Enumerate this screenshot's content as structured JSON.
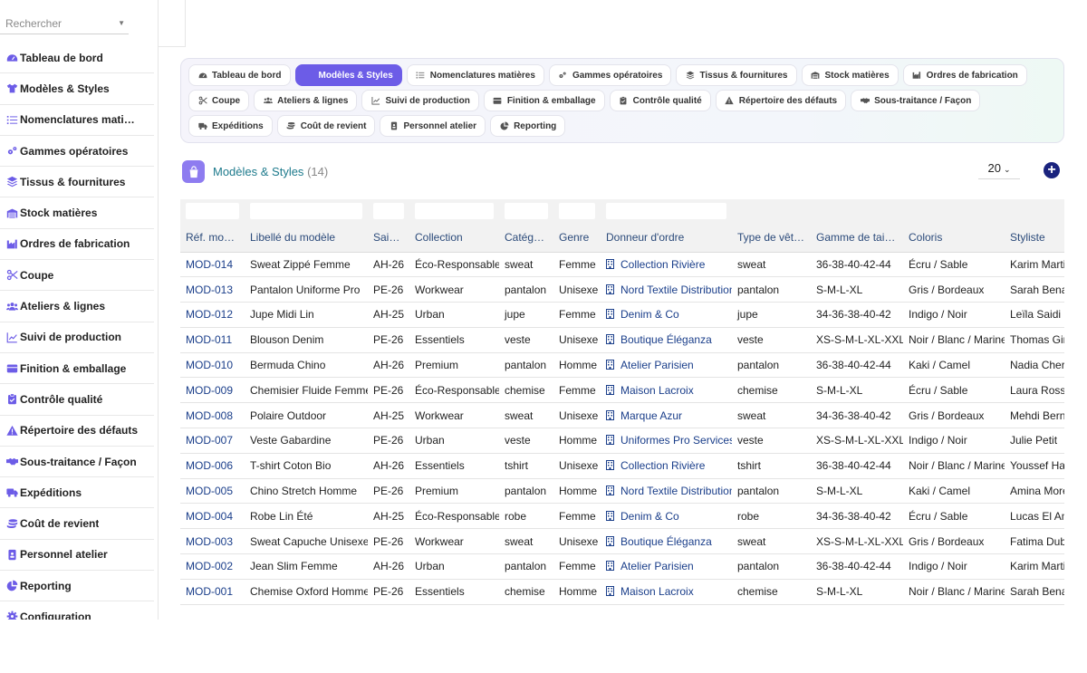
{
  "search": {
    "placeholder": "Rechercher"
  },
  "sidebar": {
    "items": [
      {
        "label": "Tableau de bord",
        "icon": "dashboard-icon"
      },
      {
        "label": "Modèles & Styles",
        "icon": "shirt-icon"
      },
      {
        "label": "Nomenclatures mati…",
        "icon": "list-icon"
      },
      {
        "label": "Gammes opératoires",
        "icon": "cogs-icon"
      },
      {
        "label": "Tissus & fournitures",
        "icon": "layers-icon"
      },
      {
        "label": "Stock matières",
        "icon": "warehouse-icon"
      },
      {
        "label": "Ordres de fabrication",
        "icon": "factory-icon"
      },
      {
        "label": "Coupe",
        "icon": "scissors-icon"
      },
      {
        "label": "Ateliers & lignes",
        "icon": "users-icon"
      },
      {
        "label": "Suivi de production",
        "icon": "chart-line-icon"
      },
      {
        "label": "Finition & emballage",
        "icon": "box-icon"
      },
      {
        "label": "Contrôle qualité",
        "icon": "clipboard-check-icon"
      },
      {
        "label": "Répertoire des défauts",
        "icon": "warning-icon"
      },
      {
        "label": "Sous-traitance / Façon",
        "icon": "handshake-icon"
      },
      {
        "label": "Expéditions",
        "icon": "truck-icon"
      },
      {
        "label": "Coût de revient",
        "icon": "coins-icon"
      },
      {
        "label": "Personnel atelier",
        "icon": "id-badge-icon"
      },
      {
        "label": "Reporting",
        "icon": "pie-chart-icon"
      },
      {
        "label": "Configuration",
        "icon": "gear-icon"
      }
    ]
  },
  "tabs": [
    {
      "label": "Tableau de bord",
      "icon": "dashboard-icon",
      "active": false
    },
    {
      "label": "Modèles & Styles",
      "icon": "shirt-icon",
      "active": true
    },
    {
      "label": "Nomenclatures matières",
      "icon": "list-icon",
      "active": false
    },
    {
      "label": "Gammes opératoires",
      "icon": "cogs-icon",
      "active": false
    },
    {
      "label": "Tissus & fournitures",
      "icon": "layers-icon",
      "active": false
    },
    {
      "label": "Stock matières",
      "icon": "warehouse-icon",
      "active": false
    },
    {
      "label": "Ordres de fabrication",
      "icon": "factory-icon",
      "active": false
    },
    {
      "label": "Coupe",
      "icon": "scissors-icon",
      "active": false
    },
    {
      "label": "Ateliers & lignes",
      "icon": "users-icon",
      "active": false
    },
    {
      "label": "Suivi de production",
      "icon": "chart-line-icon",
      "active": false
    },
    {
      "label": "Finition & emballage",
      "icon": "box-icon",
      "active": false
    },
    {
      "label": "Contrôle qualité",
      "icon": "clipboard-check-icon",
      "active": false
    },
    {
      "label": "Répertoire des défauts",
      "icon": "warning-icon",
      "active": false
    },
    {
      "label": "Sous-traitance / Façon",
      "icon": "handshake-icon",
      "active": false
    },
    {
      "label": "Expéditions",
      "icon": "truck-icon",
      "active": false
    },
    {
      "label": "Coût de revient",
      "icon": "coins-icon",
      "active": false
    },
    {
      "label": "Personnel atelier",
      "icon": "id-badge-icon",
      "active": false
    },
    {
      "label": "Reporting",
      "icon": "pie-chart-icon",
      "active": false
    }
  ],
  "page": {
    "title": "Modèles & Styles",
    "count": "(14)",
    "icon": "shopping-bag-icon",
    "page_size": "20",
    "add_icon": "plus-circle-icon"
  },
  "colors": {
    "accent": "#6c5ce7",
    "link": "#1a3e8a",
    "title": "#1d7a8c",
    "add_button": "#1a237e"
  },
  "table": {
    "columns": [
      "Réf. modèle",
      "Libellé du modèle",
      "Saison",
      "Collection",
      "Catégorie",
      "Genre",
      "Donneur d'ordre",
      "Type de vête…",
      "Gamme de tailles",
      "Coloris",
      "Styliste"
    ],
    "filter_columns": [
      true,
      true,
      true,
      true,
      true,
      true,
      true,
      false,
      false,
      false,
      false
    ],
    "rows": [
      [
        "MOD-014",
        "Sweat Zippé Femme",
        "AH-26",
        "Éco-Responsable",
        "sweat",
        "Femme",
        "Collection Rivière",
        "sweat",
        "36-38-40-42-44",
        "Écru / Sable",
        "Karim Martin"
      ],
      [
        "MOD-013",
        "Pantalon Uniforme Pro",
        "PE-26",
        "Workwear",
        "pantalon",
        "Unisexe",
        "Nord Textile Distribution",
        "pantalon",
        "S-M-L-XL",
        "Gris / Bordeaux",
        "Sarah Benali"
      ],
      [
        "MOD-012",
        "Jupe Midi Lin",
        "AH-25",
        "Urban",
        "jupe",
        "Femme",
        "Denim & Co",
        "jupe",
        "34-36-38-40-42",
        "Indigo / Noir",
        "Leïla Saidi"
      ],
      [
        "MOD-011",
        "Blouson Denim",
        "PE-26",
        "Essentiels",
        "veste",
        "Unisexe",
        "Boutique Éléganza",
        "veste",
        "XS-S-M-L-XL-XXL",
        "Noir / Blanc / Marine",
        "Thomas Girard"
      ],
      [
        "MOD-010",
        "Bermuda Chino",
        "AH-26",
        "Premium",
        "pantalon",
        "Homme",
        "Atelier Parisien",
        "pantalon",
        "36-38-40-42-44",
        "Kaki / Camel",
        "Nadia Cherif"
      ],
      [
        "MOD-009",
        "Chemisier Fluide Femme",
        "PE-26",
        "Éco-Responsable",
        "chemise",
        "Femme",
        "Maison Lacroix",
        "chemise",
        "S-M-L-XL",
        "Écru / Sable",
        "Laura Rossi"
      ],
      [
        "MOD-008",
        "Polaire Outdoor",
        "AH-25",
        "Workwear",
        "sweat",
        "Unisexe",
        "Marque Azur",
        "sweat",
        "34-36-38-40-42",
        "Gris / Bordeaux",
        "Mehdi Bernard"
      ],
      [
        "MOD-007",
        "Veste Gabardine",
        "PE-26",
        "Urban",
        "veste",
        "Homme",
        "Uniformes Pro Services",
        "veste",
        "XS-S-M-L-XL-XXL",
        "Indigo / Noir",
        "Julie Petit"
      ],
      [
        "MOD-006",
        "T-shirt Coton Bio",
        "AH-26",
        "Essentiels",
        "tshirt",
        "Unisexe",
        "Collection Rivière",
        "tshirt",
        "36-38-40-42-44",
        "Noir / Blanc / Marine",
        "Youssef Haddad"
      ],
      [
        "MOD-005",
        "Chino Stretch Homme",
        "PE-26",
        "Premium",
        "pantalon",
        "Homme",
        "Nord Textile Distribution",
        "pantalon",
        "S-M-L-XL",
        "Kaki / Camel",
        "Amina Moreau"
      ],
      [
        "MOD-004",
        "Robe Lin Été",
        "AH-25",
        "Éco-Responsable",
        "robe",
        "Femme",
        "Denim & Co",
        "robe",
        "34-36-38-40-42",
        "Écru / Sable",
        "Lucas El Amrani"
      ],
      [
        "MOD-003",
        "Sweat Capuche Unisexe",
        "PE-26",
        "Workwear",
        "sweat",
        "Unisexe",
        "Boutique Éléganza",
        "sweat",
        "XS-S-M-L-XL-XXL",
        "Gris / Bordeaux",
        "Fatima Dubois"
      ],
      [
        "MOD-002",
        "Jean Slim Femme",
        "AH-26",
        "Urban",
        "pantalon",
        "Femme",
        "Atelier Parisien",
        "pantalon",
        "36-38-40-42-44",
        "Indigo / Noir",
        "Karim Martin"
      ],
      [
        "MOD-001",
        "Chemise Oxford Homme",
        "PE-26",
        "Essentiels",
        "chemise",
        "Homme",
        "Maison Lacroix",
        "chemise",
        "S-M-L-XL",
        "Noir / Blanc / Marine",
        "Sarah Benali"
      ]
    ]
  }
}
